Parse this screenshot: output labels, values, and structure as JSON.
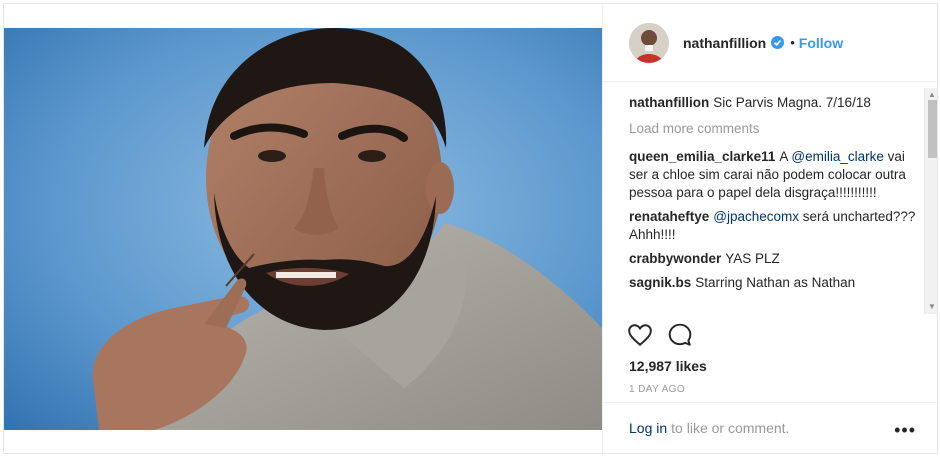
{
  "post": {
    "username": "nathanfillion",
    "follow_label": "Follow",
    "separator": "•",
    "comments": [
      {
        "user": "nathanfillion",
        "parts": [
          {
            "t": "Sic Parvis Magna. 7/16/18"
          }
        ]
      }
    ],
    "load_more": "Load more comments",
    "thread": [
      {
        "user": "queen_emilia_clarke11",
        "pre": "A ",
        "mention": "@emilia_clarke",
        "post": " vai ser a chloe sim carai não podem colocar outra pessoa para o papel dela disgraça!!!!!!!!!!!"
      },
      {
        "user": "renataheftye",
        "pre": "",
        "mention": "@jpachecomx",
        "post": " será uncharted??? Ahhh!!!!"
      },
      {
        "user": "crabbywonder",
        "pre": "YAS PLZ",
        "mention": "",
        "post": ""
      },
      {
        "user": "sagnik.bs",
        "pre": "Starring Nathan as Nathan",
        "mention": "",
        "post": ""
      }
    ],
    "likes": "12,987 likes",
    "time": "1 DAY AGO",
    "login_link": "Log in",
    "login_rest": " to like or comment.",
    "more_label": "•••"
  },
  "icons": {
    "verified": "verified-badge-icon",
    "like": "heart-icon",
    "comment": "comment-bubble-icon",
    "more": "more-options-icon"
  },
  "colors": {
    "link": "#3897f0",
    "mention": "#003569",
    "muted": "#999999",
    "text": "#262626"
  }
}
